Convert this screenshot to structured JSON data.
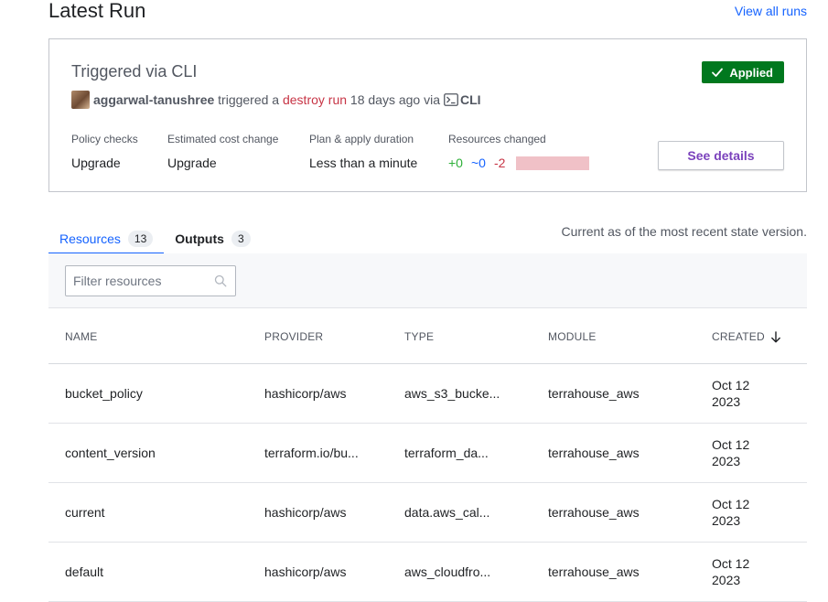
{
  "header": {
    "title": "Latest Run",
    "view_all_label": "View all runs"
  },
  "run": {
    "title": "Triggered via CLI",
    "status": "Applied",
    "username": "aggarwal-tanushree",
    "triggered_text": "triggered a",
    "run_link": "destroy run",
    "time_text": "18 days ago via",
    "cli_label": "CLI",
    "stats": [
      {
        "label": "Policy checks",
        "value": "Upgrade"
      },
      {
        "label": "Estimated cost change",
        "value": "Upgrade"
      },
      {
        "label": "Plan & apply duration",
        "value": "Less than a minute"
      }
    ],
    "resources_changed": {
      "label": "Resources changed",
      "add": "+0",
      "change": "~0",
      "destroy": "-2"
    },
    "details_button": "See details",
    "colors": {
      "applied": "#00781e",
      "add": "#2eb039",
      "change": "#1563ff",
      "destroy": "#c73445"
    }
  },
  "tabs": [
    {
      "label": "Resources",
      "count": "13",
      "active": true
    },
    {
      "label": "Outputs",
      "count": "3",
      "active": false
    }
  ],
  "state_note": "Current as of the most recent state version.",
  "filter": {
    "placeholder": "Filter resources",
    "value": ""
  },
  "table": {
    "columns": [
      "NAME",
      "PROVIDER",
      "TYPE",
      "MODULE",
      "CREATED"
    ],
    "rows": [
      {
        "name": "bucket_policy",
        "provider": "hashicorp/aws",
        "type": "aws_s3_bucke...",
        "module": "terrahouse_aws",
        "created": "Oct 12 2023"
      },
      {
        "name": "content_version",
        "provider": "terraform.io/bu...",
        "type": "terraform_da...",
        "module": "terrahouse_aws",
        "created": "Oct 12 2023"
      },
      {
        "name": "current",
        "provider": "hashicorp/aws",
        "type": "data.aws_cal...",
        "module": "terrahouse_aws",
        "created": "Oct 12 2023"
      },
      {
        "name": "default",
        "provider": "hashicorp/aws",
        "type": "aws_cloudfro...",
        "module": "terrahouse_aws",
        "created": "Oct 12 2023"
      }
    ]
  }
}
